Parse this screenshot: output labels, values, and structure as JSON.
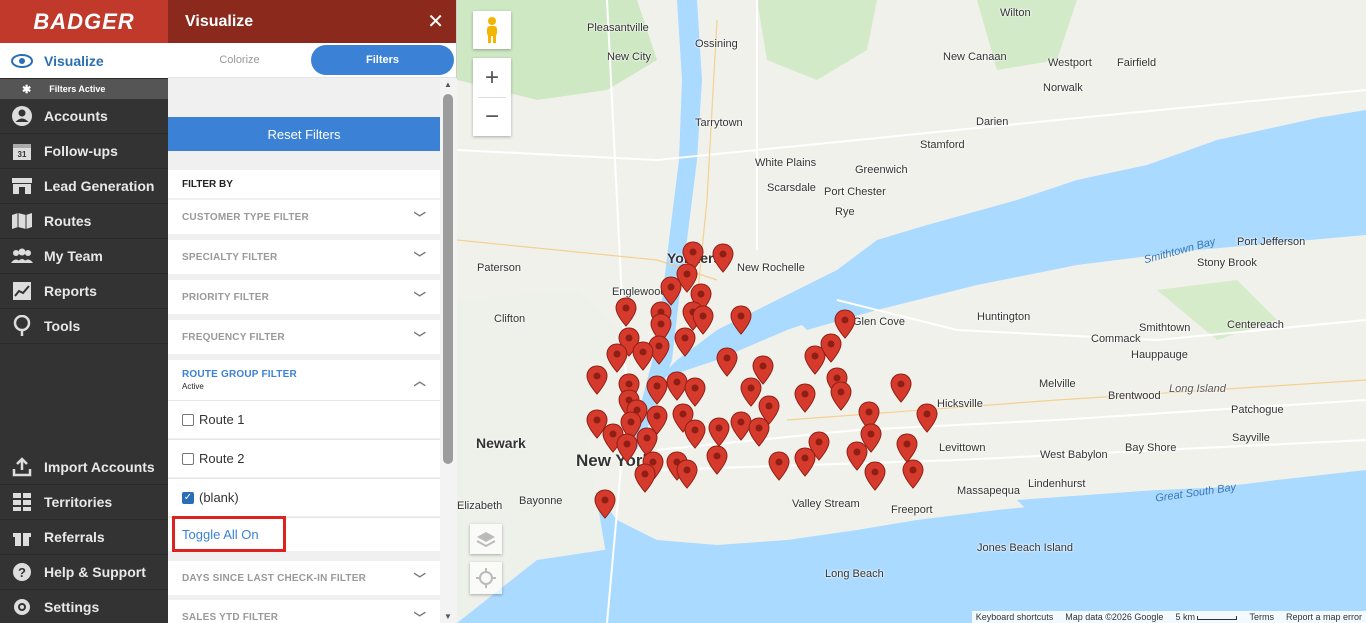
{
  "app": {
    "logo": "BADGER"
  },
  "nav": {
    "items": [
      {
        "label": "Visualize",
        "icon": "eye-icon",
        "active": true
      },
      {
        "label": "Accounts",
        "icon": "person-icon"
      },
      {
        "label": "Follow-ups",
        "icon": "calendar-icon"
      },
      {
        "label": "Lead Generation",
        "icon": "store-icon"
      },
      {
        "label": "Routes",
        "icon": "map-icon"
      },
      {
        "label": "My Team",
        "icon": "team-icon"
      },
      {
        "label": "Reports",
        "icon": "chart-icon"
      },
      {
        "label": "Tools",
        "icon": "pin-icon"
      }
    ],
    "sub_active": "Filters Active",
    "bottom_items": [
      {
        "label": "Import Accounts",
        "icon": "upload-icon"
      },
      {
        "label": "Territories",
        "icon": "grid-icon"
      },
      {
        "label": "Referrals",
        "icon": "gift-icon"
      },
      {
        "label": "Help & Support",
        "icon": "help-icon"
      },
      {
        "label": "Settings",
        "icon": "gear-icon"
      }
    ]
  },
  "panel": {
    "title": "Visualize",
    "close": "✕",
    "tabs": [
      "Colorize",
      "Filters"
    ],
    "active_tab": "Filters",
    "reset_label": "Reset Filters",
    "filter_by": "FILTER BY",
    "filters": [
      "CUSTOMER TYPE FILTER",
      "SPECIALTY FILTER",
      "PRIORITY FILTER",
      "FREQUENCY FILTER"
    ],
    "open_filter": {
      "label": "ROUTE GROUP FILTER",
      "status": "Active"
    },
    "options": [
      {
        "label": "Route 1",
        "checked": false
      },
      {
        "label": "Route 2",
        "checked": false
      },
      {
        "label": "(blank)",
        "checked": true
      }
    ],
    "toggle_all": "Toggle All On",
    "more_filters": [
      "DAYS SINCE LAST CHECK-IN FILTER",
      "SALES YTD FILTER"
    ]
  },
  "map": {
    "labels": {
      "yonkers": "Yonkers",
      "newark": "Newark",
      "new_york": "New York",
      "white_plains": "White Plains",
      "new_rochelle": "New Rochelle",
      "stamford": "Stamford",
      "greenwich": "Greenwich",
      "port_chester": "Port Chester",
      "tarrytown": "Tarrytown",
      "ossining": "Ossining",
      "pleasantville": "Pleasantville",
      "new_city": "New City",
      "paterson": "Paterson",
      "clifton": "Clifton",
      "englewood": "Englewood",
      "glen_cove": "Glen Cove",
      "huntington": "Huntington",
      "hicksville": "Hicksville",
      "levittown": "Levittown",
      "freeport": "Freeport",
      "valley_stream": "Valley Stream",
      "massapequa": "Massapequa",
      "long_beach": "Long Beach",
      "jones_beach": "Jones Beach Island",
      "melville": "Melville",
      "commack": "Commack",
      "hauppauge": "Hauppauge",
      "smithtown": "Smithtown",
      "brentwood": "Brentwood",
      "bay_shore": "Bay Shore",
      "sayville": "Sayville",
      "patchogue": "Patchogue",
      "lindenhurst": "Lindenhurst",
      "west_babylon": "West Babylon",
      "stony_brook": "Stony Brook",
      "port_jefferson": "Port Jefferson",
      "centereach": "Centereach",
      "norwalk": "Norwalk",
      "darien": "Darien",
      "westport": "Westport",
      "fairfield": "Fairfield",
      "new_canaan": "New Canaan",
      "wilton": "Wilton",
      "bayonne": "Bayonne",
      "elizabeth": "Elizabeth",
      "scarsdale": "Scarsdale",
      "rye": "Rye",
      "smithtown_bay": "Smithtown Bay",
      "great_south_bay": "Great South Bay",
      "long_island": "Long Island"
    },
    "footer": {
      "shortcuts": "Keyboard shortcuts",
      "data": "Map data ©2026 Google",
      "scale": "5 km",
      "terms": "Terms",
      "report": "Report a map error"
    },
    "zoom_in": "+",
    "zoom_out": "−",
    "marker_color": "#d63a2c"
  }
}
